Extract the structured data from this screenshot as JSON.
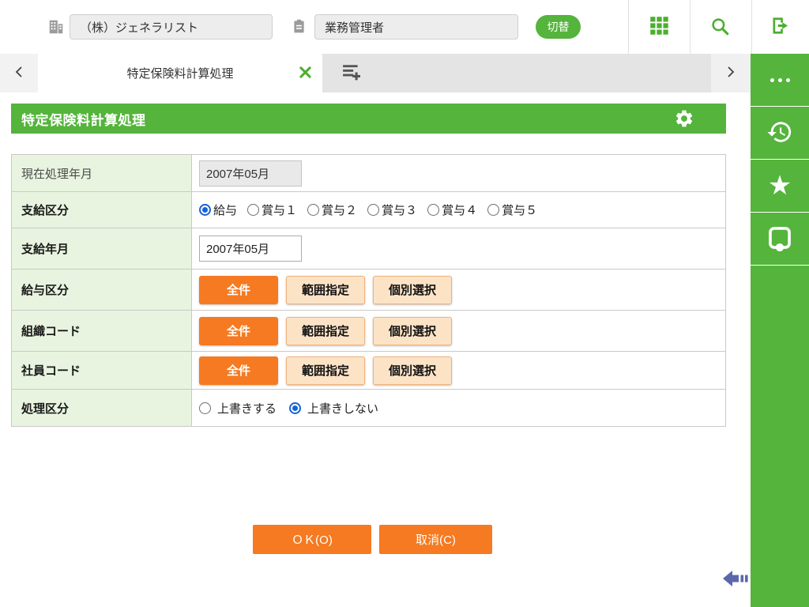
{
  "header": {
    "company_field": {
      "value": "（株）ジェネラリスト"
    },
    "role_field": {
      "value": "業務管理者"
    },
    "switch_button": "切替"
  },
  "tab_bar": {
    "active_tab": "特定保険料計算処理"
  },
  "page": {
    "title": "特定保険料計算処理"
  },
  "form": {
    "rows": [
      {
        "type": "readonly",
        "label": "現在処理年月",
        "value": "2007年05月"
      },
      {
        "type": "radio-group",
        "label": "支給区分",
        "options": [
          "給与",
          "賞与１",
          "賞与２",
          "賞与３",
          "賞与４",
          "賞与５"
        ],
        "selected": "給与"
      },
      {
        "type": "text",
        "label": "支給年月",
        "value": "2007年05月"
      },
      {
        "type": "buttons",
        "label": "給与区分",
        "buttons": [
          "全件",
          "範囲指定",
          "個別選択"
        ],
        "active": "全件"
      },
      {
        "type": "buttons",
        "label": "組織コード",
        "buttons": [
          "全件",
          "範囲指定",
          "個別選択"
        ],
        "active": "全件"
      },
      {
        "type": "buttons",
        "label": "社員コード",
        "buttons": [
          "全件",
          "範囲指定",
          "個別選択"
        ],
        "active": "全件"
      },
      {
        "type": "radio-group",
        "label": "処理区分",
        "options": [
          "上書きする",
          "上書きしない"
        ],
        "selected": "上書きしない"
      }
    ]
  },
  "actions": {
    "ok": "ＯＫ(O)",
    "cancel": "取消(C)"
  },
  "icons": {
    "header": [
      "building-icon",
      "clipboard-icon",
      "apps-grid-icon",
      "search-icon",
      "logout-icon"
    ],
    "tab_bar": [
      "prev-tab-icon",
      "next-tab-icon",
      "close-icon",
      "add-tab-icon"
    ],
    "titlebar": [
      "gear-icon"
    ],
    "sidebar": [
      "more-ellipsis-icon",
      "history-icon",
      "favorite-star-icon",
      "device-icon"
    ],
    "footer": [
      "collapse-panel-icon"
    ]
  },
  "colors": {
    "brand_green": "#54B43B",
    "accent_orange": "#F57A21",
    "peach_button_bg": "#FCE3C6",
    "peach_button_border": "#F2B27A",
    "label_cell_bg": "#E8F4DF",
    "radio_blue": "#1463D8",
    "collapse_arrow": "#5C67AB"
  }
}
